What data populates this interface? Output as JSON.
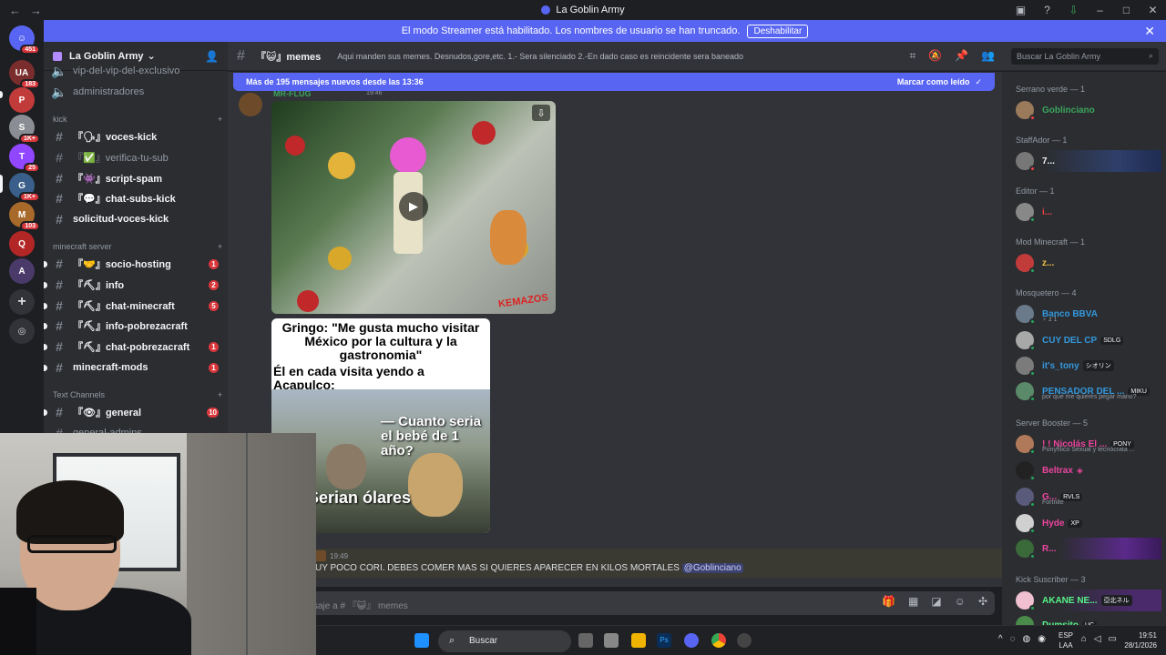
{
  "titlebar": {
    "title": "La Goblin Army"
  },
  "banner": {
    "text": "El modo Streamer está habilitado. Los nombres de usuario se han truncado.",
    "button": "Deshabilitar"
  },
  "rail": {
    "badges": [
      "451",
      "183",
      "1K+",
      "25",
      "1K+",
      "103"
    ]
  },
  "sidebar": {
    "server_name": "La Goblin Army",
    "top_channels": [
      "vip-del-vip-del-exclusivo",
      "administradores"
    ],
    "categories": [
      "kick",
      "minecraft server",
      "Text Channels"
    ],
    "channels_kick": [
      {
        "label": "『🗣』voces-kick"
      },
      {
        "label": "『✅』verifica-tu-sub"
      },
      {
        "label": "『👾』script-spam"
      },
      {
        "label": "『💬』chat-subs-kick"
      },
      {
        "label": "solicitud-voces-kick"
      }
    ],
    "channels_mc": [
      {
        "label": "『🤝』socio-hosting",
        "badge": "1"
      },
      {
        "label": "『⛏』info",
        "badge": "2"
      },
      {
        "label": "『⛏』chat-minecraft",
        "badge": "5"
      },
      {
        "label": "『⛏』info-pobrezacraft",
        "badge": "1"
      },
      {
        "label": "『⛏』chat-pobrezacraft",
        "badge": "1"
      },
      {
        "label": "minecraft-mods",
        "badge": "1"
      }
    ],
    "channels_text": [
      {
        "label": "『👁』general",
        "badge": "10"
      },
      {
        "label": "general-admins"
      }
    ]
  },
  "header": {
    "channel": "『😺』memes",
    "topic": "Aqui manden sus memes. Desnudos,gore,etc. 1.- Sera silenciado 2.-En dado caso es reincidente sera baneado",
    "search_placeholder": "Buscar La Goblin Army"
  },
  "new_messages": {
    "text": "Más de 195 mensajes nuevos desde las 13:36",
    "mark": "Marcar como leído"
  },
  "messages": [
    {
      "author": "MR-FLUG",
      "time": "19:46"
    },
    {
      "time": "19:49",
      "text": "UY POCO CORI. DEBES COMER MAS SI QUIERES APARECER EN KILOS MORTALES ",
      "mention": "@Goblinciano"
    }
  ],
  "media": {
    "video_watermark": "KEMAZOS",
    "meme_top": "Gringo: \"Me gusta mucho visitar México por la cultura y la gastronomia\"",
    "meme_mid": "Él en cada visita yendo a Acapulco:",
    "meme_bubble": "— Cuanto seria el bebé de 1 año?",
    "meme_bottom": "Serian ólares"
  },
  "composer": {
    "placeholder": "saje a # 『😺』 memes"
  },
  "members": {
    "roles": [
      "Serrano verde — 1",
      "StaffAdor — 1",
      "Editor — 1",
      "Mod Minecraft — 1",
      "Mosquetero — 4",
      "Server Booster — 5",
      "Kick Suscriber — 3"
    ],
    "list": [
      {
        "name": "Goblinciano",
        "color": "#3ba55c"
      },
      {
        "name": "7...",
        "color": "#f2f3f5"
      },
      {
        "name": "i...",
        "color": "#ed4245"
      },
      {
        "name": "z...",
        "color": "#f0c040"
      },
      {
        "name": "Banco BBVA",
        "color": "#3498db",
        "sub": "♀ z 1"
      },
      {
        "name": "CUY DEL CP",
        "color": "#3498db",
        "tag": "SDLG"
      },
      {
        "name": "it's_tony",
        "color": "#3498db",
        "tag": "シオリン"
      },
      {
        "name": "PENSADOR DEL ...",
        "color": "#3498db",
        "tag": "MIKU",
        "sub": "por que me quieres pegar mano?"
      },
      {
        "name": "! ! Nicolás El ...",
        "color": "#eb459e",
        "tag": "PONY",
        "sub": "Ponyfílico Sexual y tecnócrata ..."
      },
      {
        "name": "Beltrax",
        "color": "#eb459e"
      },
      {
        "name": "G...",
        "color": "#eb459e",
        "tag": "RVLS",
        "sub": "Fortnite"
      },
      {
        "name": "Hyde",
        "color": "#eb459e",
        "tag": "XP"
      },
      {
        "name": "R...",
        "color": "#eb459e"
      },
      {
        "name": "AKANE NE...",
        "color": "#57f287",
        "tag": "亞北ネル"
      },
      {
        "name": "Dumsito",
        "color": "#57f287",
        "tag": "UC"
      }
    ]
  },
  "taskbar": {
    "search": "Buscar",
    "lang1": "ESP",
    "lang2": "LAA",
    "time": "19:51",
    "date": "28/1/2026"
  }
}
